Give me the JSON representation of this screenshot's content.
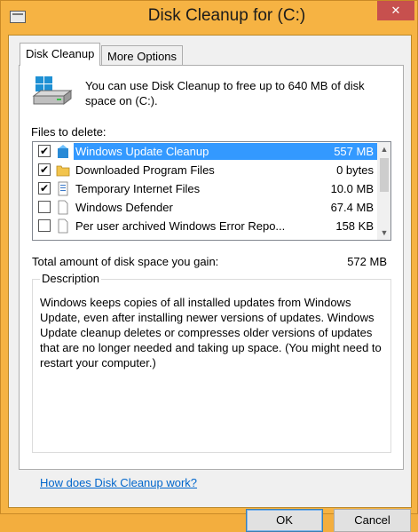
{
  "window": {
    "title": "Disk Cleanup for  (C:)",
    "close_label": "✕"
  },
  "tabs": [
    {
      "label": "Disk Cleanup",
      "active": true
    },
    {
      "label": "More Options",
      "active": false
    }
  ],
  "intro": "You can use Disk Cleanup to free up to 640 MB of disk space on  (C:).",
  "files_label": "Files to delete:",
  "files": [
    {
      "name": "Windows Update Cleanup",
      "size": "557 MB",
      "checked": true,
      "icon": "recycle-icon",
      "selected": true
    },
    {
      "name": "Downloaded Program Files",
      "size": "0 bytes",
      "checked": true,
      "icon": "folder-icon",
      "selected": false
    },
    {
      "name": "Temporary Internet Files",
      "size": "10.0 MB",
      "checked": true,
      "icon": "document-icon",
      "selected": false
    },
    {
      "name": "Windows Defender",
      "size": "67.4 MB",
      "checked": false,
      "icon": "blank-page-icon",
      "selected": false
    },
    {
      "name": "Per user archived Windows Error Repo...",
      "size": "158 KB",
      "checked": false,
      "icon": "blank-page-icon",
      "selected": false
    }
  ],
  "total": {
    "label": "Total amount of disk space you gain:",
    "value": "572 MB"
  },
  "description": {
    "title": "Description",
    "text": "Windows keeps copies of all installed updates from Windows Update, even after installing newer versions of updates. Windows Update cleanup deletes or compresses older versions of updates that are no longer needed and taking up space. (You might need to restart your computer.)"
  },
  "help_link": "How does Disk Cleanup work?",
  "buttons": {
    "ok": "OK",
    "cancel": "Cancel"
  },
  "colors": {
    "selection": "#3399ff",
    "link": "#0066cc",
    "frame": "#f6b343"
  }
}
